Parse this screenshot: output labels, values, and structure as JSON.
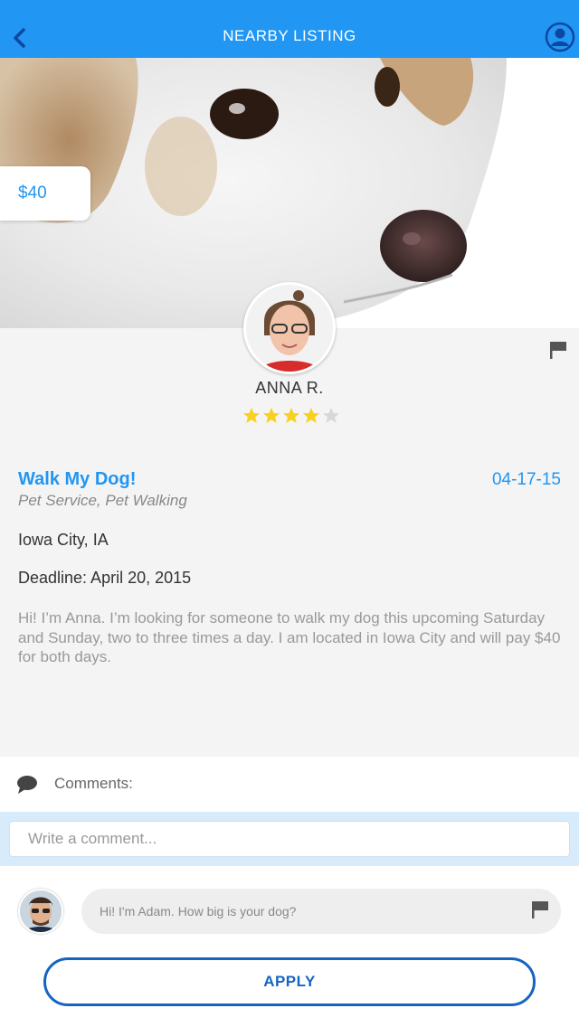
{
  "nav": {
    "title": "NEARBY LISTING",
    "back_icon": "chevron-left-icon",
    "profile_icon": "user-icon"
  },
  "hero": {
    "image": "dog-photo",
    "price": "$40"
  },
  "host": {
    "name": "ANNA R.",
    "rating": 4,
    "rating_max": 5
  },
  "listing": {
    "title": "Walk My Dog!",
    "date": "04-17-15",
    "category": "Pet Service, Pet Walking",
    "location": "Iowa City, IA",
    "deadline": "Deadline: April 20, 2015",
    "description": "Hi! I’m Anna. I’m looking for someone to walk my dog this upcoming Saturday and Sunday, two to three times a day. I am located in Iowa City and will pay $40 for both days."
  },
  "comments": {
    "label": "Comments:",
    "input_placeholder": "Write a comment...",
    "items": [
      {
        "text": "Hi! I'm Adam. How big is your dog?"
      }
    ]
  },
  "actions": {
    "apply_label": "APPLY"
  },
  "colors": {
    "primary": "#2196f3",
    "apply_border": "#1565c0",
    "star_on": "#f7d11e",
    "star_off": "#d8d8d8"
  }
}
